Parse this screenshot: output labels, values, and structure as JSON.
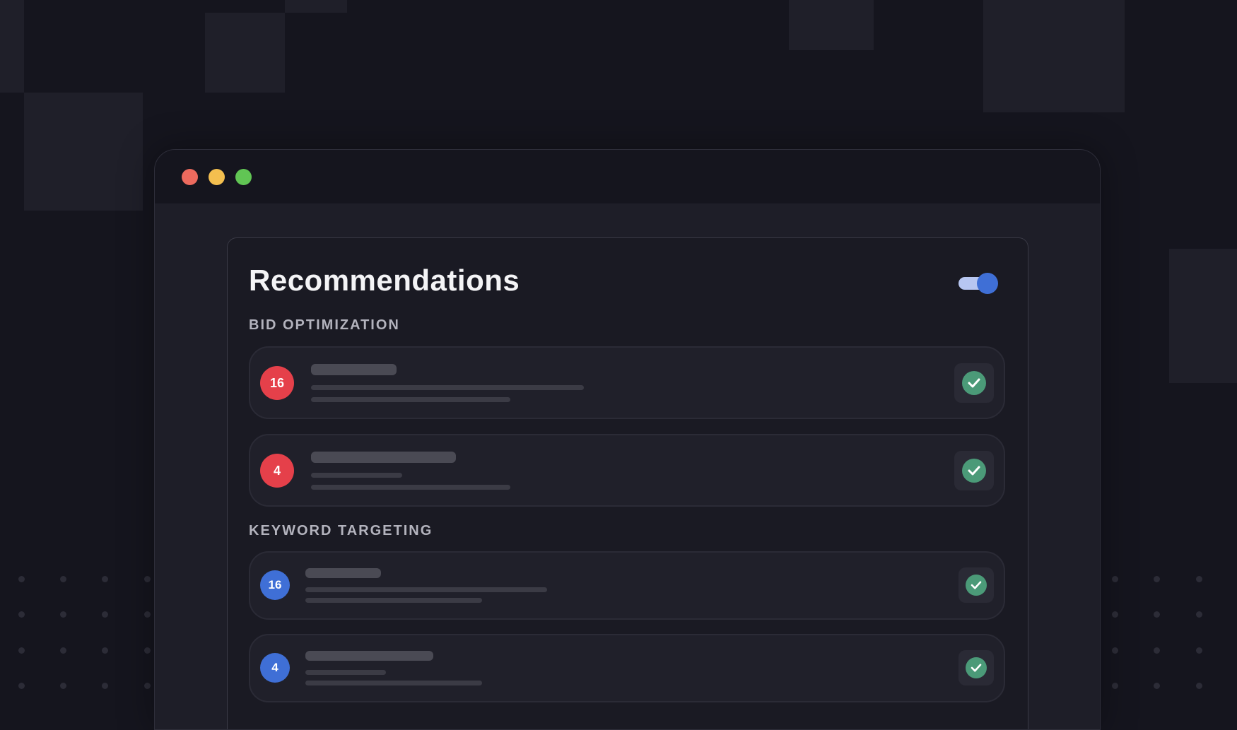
{
  "window": {
    "controls": [
      "close",
      "minimize",
      "maximize"
    ]
  },
  "panel": {
    "title": "Recommendations",
    "toggle": {
      "state": "on",
      "colors": {
        "knob": "#3f6fd6",
        "track": "#b7c6f1"
      }
    },
    "sections": [
      {
        "label": "BID OPTIMIZATION",
        "badge_color": "#e5404a",
        "items": [
          {
            "count": "16",
            "status": "check-icon"
          },
          {
            "count": "4",
            "status": "check-icon"
          }
        ]
      },
      {
        "label": "KEYWORD TARGETING",
        "badge_color": "#3f6fd6",
        "items": [
          {
            "count": "16",
            "status": "check-icon"
          },
          {
            "count": "4",
            "status": "check-icon"
          }
        ]
      }
    ]
  },
  "colors": {
    "background": "#15151e",
    "check": "#4b9a78",
    "badge_red": "#e5404a",
    "badge_blue": "#3f6fd6"
  }
}
